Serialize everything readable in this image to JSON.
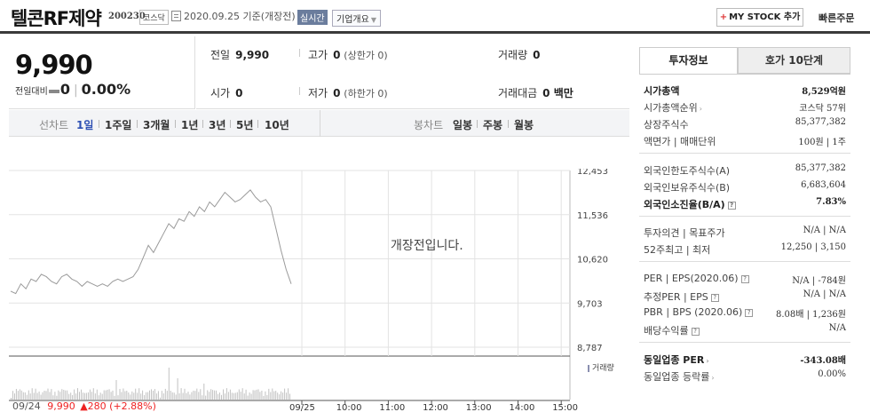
{
  "header": {
    "name": "텔콘RF제약",
    "code": "200230",
    "market": "코스닥",
    "date": "2020.09.25  기준(개장전)",
    "realtime": "실시간",
    "corp_info": "기업개요",
    "mystock": "MY STOCK 추가",
    "quick": "빠른주문"
  },
  "price": {
    "current": "9,990",
    "change_label": "전일대비",
    "change": "0",
    "pct": "0.00%"
  },
  "info": {
    "prev_label": "전일",
    "prev": "9,990",
    "high_label": "고가",
    "high": "0",
    "upper_label": "(상한가 0)",
    "vol_label": "거래량",
    "vol": "0",
    "open_label": "시가",
    "open": "0",
    "low_label": "저가",
    "low": "0",
    "lower_label": "(하한가 0)",
    "amt_label": "거래대금",
    "amt": "0 백만"
  },
  "tabs": {
    "line_label": "선차트",
    "line": [
      "1일",
      "1주일",
      "3개월",
      "1년",
      "3년",
      "5년",
      "10년"
    ],
    "candle_label": "봉차트",
    "candle": [
      "일봉",
      "주봉",
      "월봉"
    ]
  },
  "chart": {
    "notice": "개장전입니다.",
    "vol_label": "거래량",
    "bottom": "09/24",
    "bottom_price": "9,990",
    "bottom_change": "▲280 (+2.88%)",
    "colors": {
      "up": "#e22",
      "line": "#999",
      "grid": "#e6e6e6"
    }
  },
  "chart_data": {
    "type": "line",
    "y_ticks": [
      "12,453",
      "11,536",
      "10,620",
      "9,703",
      "8,787"
    ],
    "ylim": [
      8787,
      12453
    ],
    "x_ticks": [
      "09/25",
      "10:00",
      "11:00",
      "12:00",
      "13:00",
      "14:00",
      "15:00"
    ],
    "y": [
      9950,
      9900,
      10100,
      10000,
      10200,
      10150,
      10300,
      10250,
      10150,
      10100,
      10250,
      10300,
      10200,
      10150,
      10050,
      10150,
      10100,
      10050,
      10100,
      10050,
      10150,
      10200,
      10150,
      10200,
      10250,
      10400,
      10650,
      10900,
      10750,
      10950,
      11150,
      11350,
      11250,
      11450,
      11400,
      11600,
      11500,
      11700,
      11600,
      11800,
      11700,
      11850,
      12000,
      11900,
      11800,
      11850,
      11950,
      12050,
      11900,
      11800,
      11850,
      11700,
      11250,
      10800,
      10400,
      10100
    ]
  },
  "right": {
    "tab1": "투자정보",
    "tab2": "호가 10단계",
    "rows1": [
      {
        "k": "시가총액",
        "v": "8,529억원",
        "bold": true
      },
      {
        "k": "시가총액순위",
        "v": "코스닥 57위",
        "arrow": true
      },
      {
        "k": "상장주식수",
        "v": "85,377,382"
      },
      {
        "k": "액면가 | 매매단위",
        "v": "100원 | 1주"
      }
    ],
    "rows2": [
      {
        "k": "외국인한도주식수(A)",
        "v": "85,377,382"
      },
      {
        "k": "외국인보유주식수(B)",
        "v": "6,683,604"
      },
      {
        "k": "외국인소진율(B/A)",
        "v": "7.83%",
        "bold": true,
        "q": true
      }
    ],
    "rows3": [
      {
        "k": "투자의견 | 목표주가",
        "v": "N/A | N/A"
      },
      {
        "k": "52주최고 | 최저",
        "v": "12,250 | 3,150"
      }
    ],
    "rows4": [
      {
        "k": "PER | EPS(2020.06)",
        "v": "N/A | -784원",
        "q": true
      },
      {
        "k": "추정PER | EPS",
        "v": "N/A | N/A",
        "q": true
      },
      {
        "k": "PBR | BPS (2020.06)",
        "v": "8.08배 | 1,236원",
        "q": true
      },
      {
        "k": "배당수익률",
        "v": "N/A",
        "q": true
      }
    ],
    "rows5": [
      {
        "k": "동일업종 PER",
        "v": "-343.08배",
        "bold": true,
        "arrow": true
      },
      {
        "k": "동일업종 등락률",
        "v": "0.00%",
        "arrow": true
      }
    ]
  }
}
